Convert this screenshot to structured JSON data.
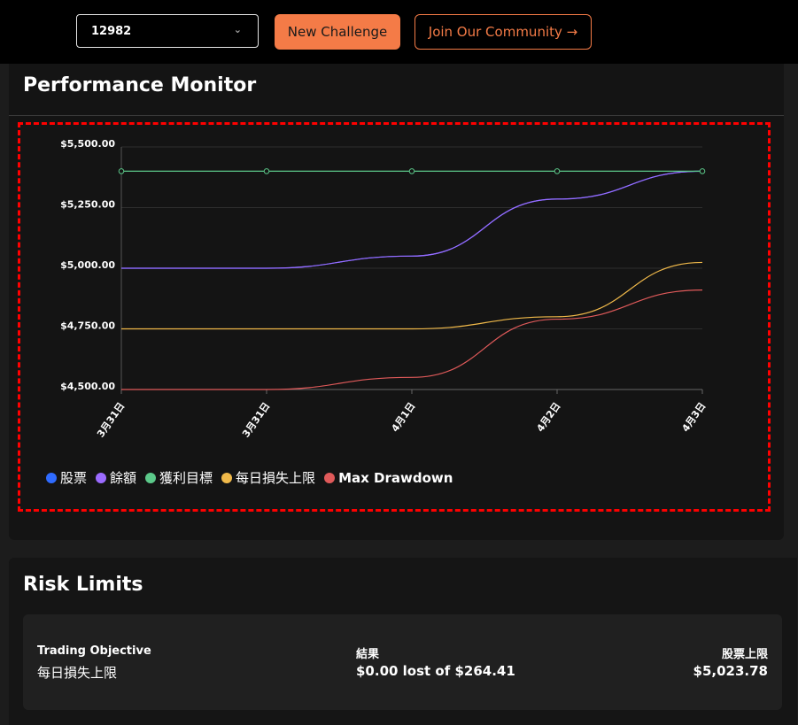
{
  "topbar": {
    "account_select": {
      "value": "12982"
    },
    "new_challenge_label": "New Challenge",
    "join_community_label": "Join Our Community →"
  },
  "performance": {
    "title": "Performance Monitor"
  },
  "chart_data": {
    "type": "line",
    "categories": [
      "3月31日",
      "3月31日",
      "4月1日",
      "4月2日",
      "4月3日"
    ],
    "ylim": [
      4500,
      5500
    ],
    "yticks": [
      "$5,500.00",
      "$5,250.00",
      "$5,000.00",
      "$4,750.00",
      "$4,500.00"
    ],
    "ytick_values": [
      5500,
      5250,
      5000,
      4750,
      4500
    ],
    "series": [
      {
        "name": "股票",
        "color": "#2f6bff",
        "values": [
          5000,
          5000,
          5050,
          5285,
          5400
        ]
      },
      {
        "name": "餘額",
        "color": "#9b6bff",
        "values": [
          5000,
          5000,
          5050,
          5285,
          5400
        ]
      },
      {
        "name": "獲利目標",
        "color": "#5cc98a",
        "values": [
          5400,
          5400,
          5400,
          5400,
          5400
        ],
        "markers": true
      },
      {
        "name": "每日損失上限",
        "color": "#f0b94a",
        "values": [
          4750,
          4750,
          4750,
          4800,
          5024
        ]
      },
      {
        "name": "Max Drawdown",
        "color": "#e05a5a",
        "values": [
          4500,
          4500,
          4550,
          4790,
          4910
        ]
      }
    ],
    "legend_position": "bottom-left",
    "grid": true
  },
  "risk": {
    "title": "Risk Limits",
    "objective_label": "Trading Objective",
    "objective_value": "每日損失上限",
    "result_label": "結果",
    "result_value": "$0.00 lost of $264.41",
    "limit_label": "股票上限",
    "limit_value": "$5,023.78"
  }
}
